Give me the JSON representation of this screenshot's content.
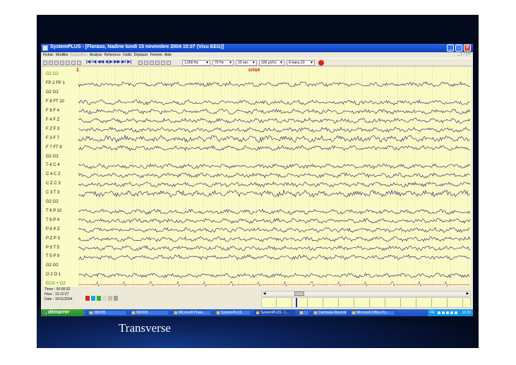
{
  "window": {
    "title": "SystemPLUS - [Floraso, Nadine lundi 15 novembre 2004 15:07 (Visu EEG)]",
    "minimize_label": "_",
    "maximize_label": "□",
    "close_label": "✕"
  },
  "menu": {
    "items": [
      {
        "label": "Fichier",
        "enabled": true
      },
      {
        "label": "Modifier",
        "enabled": true
      },
      {
        "label": "Acquisition",
        "enabled": false
      },
      {
        "label": "Analyse",
        "enabled": true
      },
      {
        "label": "Reference",
        "enabled": true
      },
      {
        "label": "Outils",
        "enabled": true
      },
      {
        "label": "Déplacer",
        "enabled": true
      },
      {
        "label": "Fenetre",
        "enabled": true
      },
      {
        "label": "Aide",
        "enabled": true
      }
    ],
    "window_controls": "_ | ♂ | ×"
  },
  "toolbar": {
    "nav_glyphs": "|◀ /◀ ◀◀ ◀ ▶ ▶▶ ▶/ ▶|",
    "filter_high": "1,000 Hz",
    "filter_low": "70 Hz",
    "timebase": "20 sec",
    "sensitivity": "100 µV/cr",
    "montage": "6-trans.23"
  },
  "eeg": {
    "marker_number": "1",
    "marker_event": "crise",
    "channels": [
      {
        "label": "G2 G2",
        "type": "ref",
        "color": "#2c8a18"
      },
      {
        "label": "FP 2 FP 1",
        "type": "signal"
      },
      {
        "label": "G2 G2",
        "type": "ref"
      },
      {
        "label": "F 8 FT 10",
        "type": "signal"
      },
      {
        "label": "F 8 F 4",
        "type": "signal"
      },
      {
        "label": "F 4 F Z",
        "type": "signal"
      },
      {
        "label": "F Z F 3",
        "type": "signal"
      },
      {
        "label": "F 3 F 7",
        "type": "signal"
      },
      {
        "label": "F 7 FT 9",
        "type": "signal"
      },
      {
        "label": "G2 G2",
        "type": "ref"
      },
      {
        "label": "T 4 C 4",
        "type": "signal"
      },
      {
        "label": "C 4 C Z",
        "type": "signal"
      },
      {
        "label": "C Z C 3",
        "type": "signal"
      },
      {
        "label": "C 3 T 3",
        "type": "signal"
      },
      {
        "label": "G2 G2",
        "type": "ref"
      },
      {
        "label": "T 6 P 10",
        "type": "signal"
      },
      {
        "label": "T 6 P 4",
        "type": "signal"
      },
      {
        "label": "P 4 P Z",
        "type": "signal"
      },
      {
        "label": "P Z P 3",
        "type": "signal"
      },
      {
        "label": "P 3 T 5",
        "type": "signal"
      },
      {
        "label": "T 5 P 9",
        "type": "signal"
      },
      {
        "label": "G2 G2",
        "type": "ref"
      },
      {
        "label": "O 2 O 1",
        "type": "signal"
      },
      {
        "label": "ECG + G2",
        "type": "ecg",
        "color": "#2c8a18"
      }
    ],
    "trace_color": "#1a1a7a",
    "ecg_color": "#c0208a",
    "background": "#fbfbc6"
  },
  "status": {
    "timer": "Timer : 00:00:32",
    "hour": "Hour   : 15:12:27",
    "date": "Date   : 15/11/2004"
  },
  "taskbar": {
    "start_label": "démarrer",
    "tasks": [
      {
        "label": "082005",
        "active": false,
        "dim": false
      },
      {
        "label": "082005",
        "active": false,
        "dim": false
      },
      {
        "label": "Microsoft Powe...",
        "active": false,
        "dim": false
      },
      {
        "label": "SystemPLUS",
        "active": false,
        "dim": false
      },
      {
        "label": "SystemPLUS - [...",
        "active": true,
        "dim": false
      },
      {
        "label": "Cam",
        "active": false,
        "dim": true
      },
      {
        "label": "Camtasia Recorder",
        "active": false,
        "dim": false
      },
      {
        "label": "Microsoft Office Po...",
        "active": false,
        "dim": false
      }
    ],
    "tray_lang": "FR",
    "tray_clock": "16:29"
  },
  "slide": {
    "caption": "Transverse"
  }
}
